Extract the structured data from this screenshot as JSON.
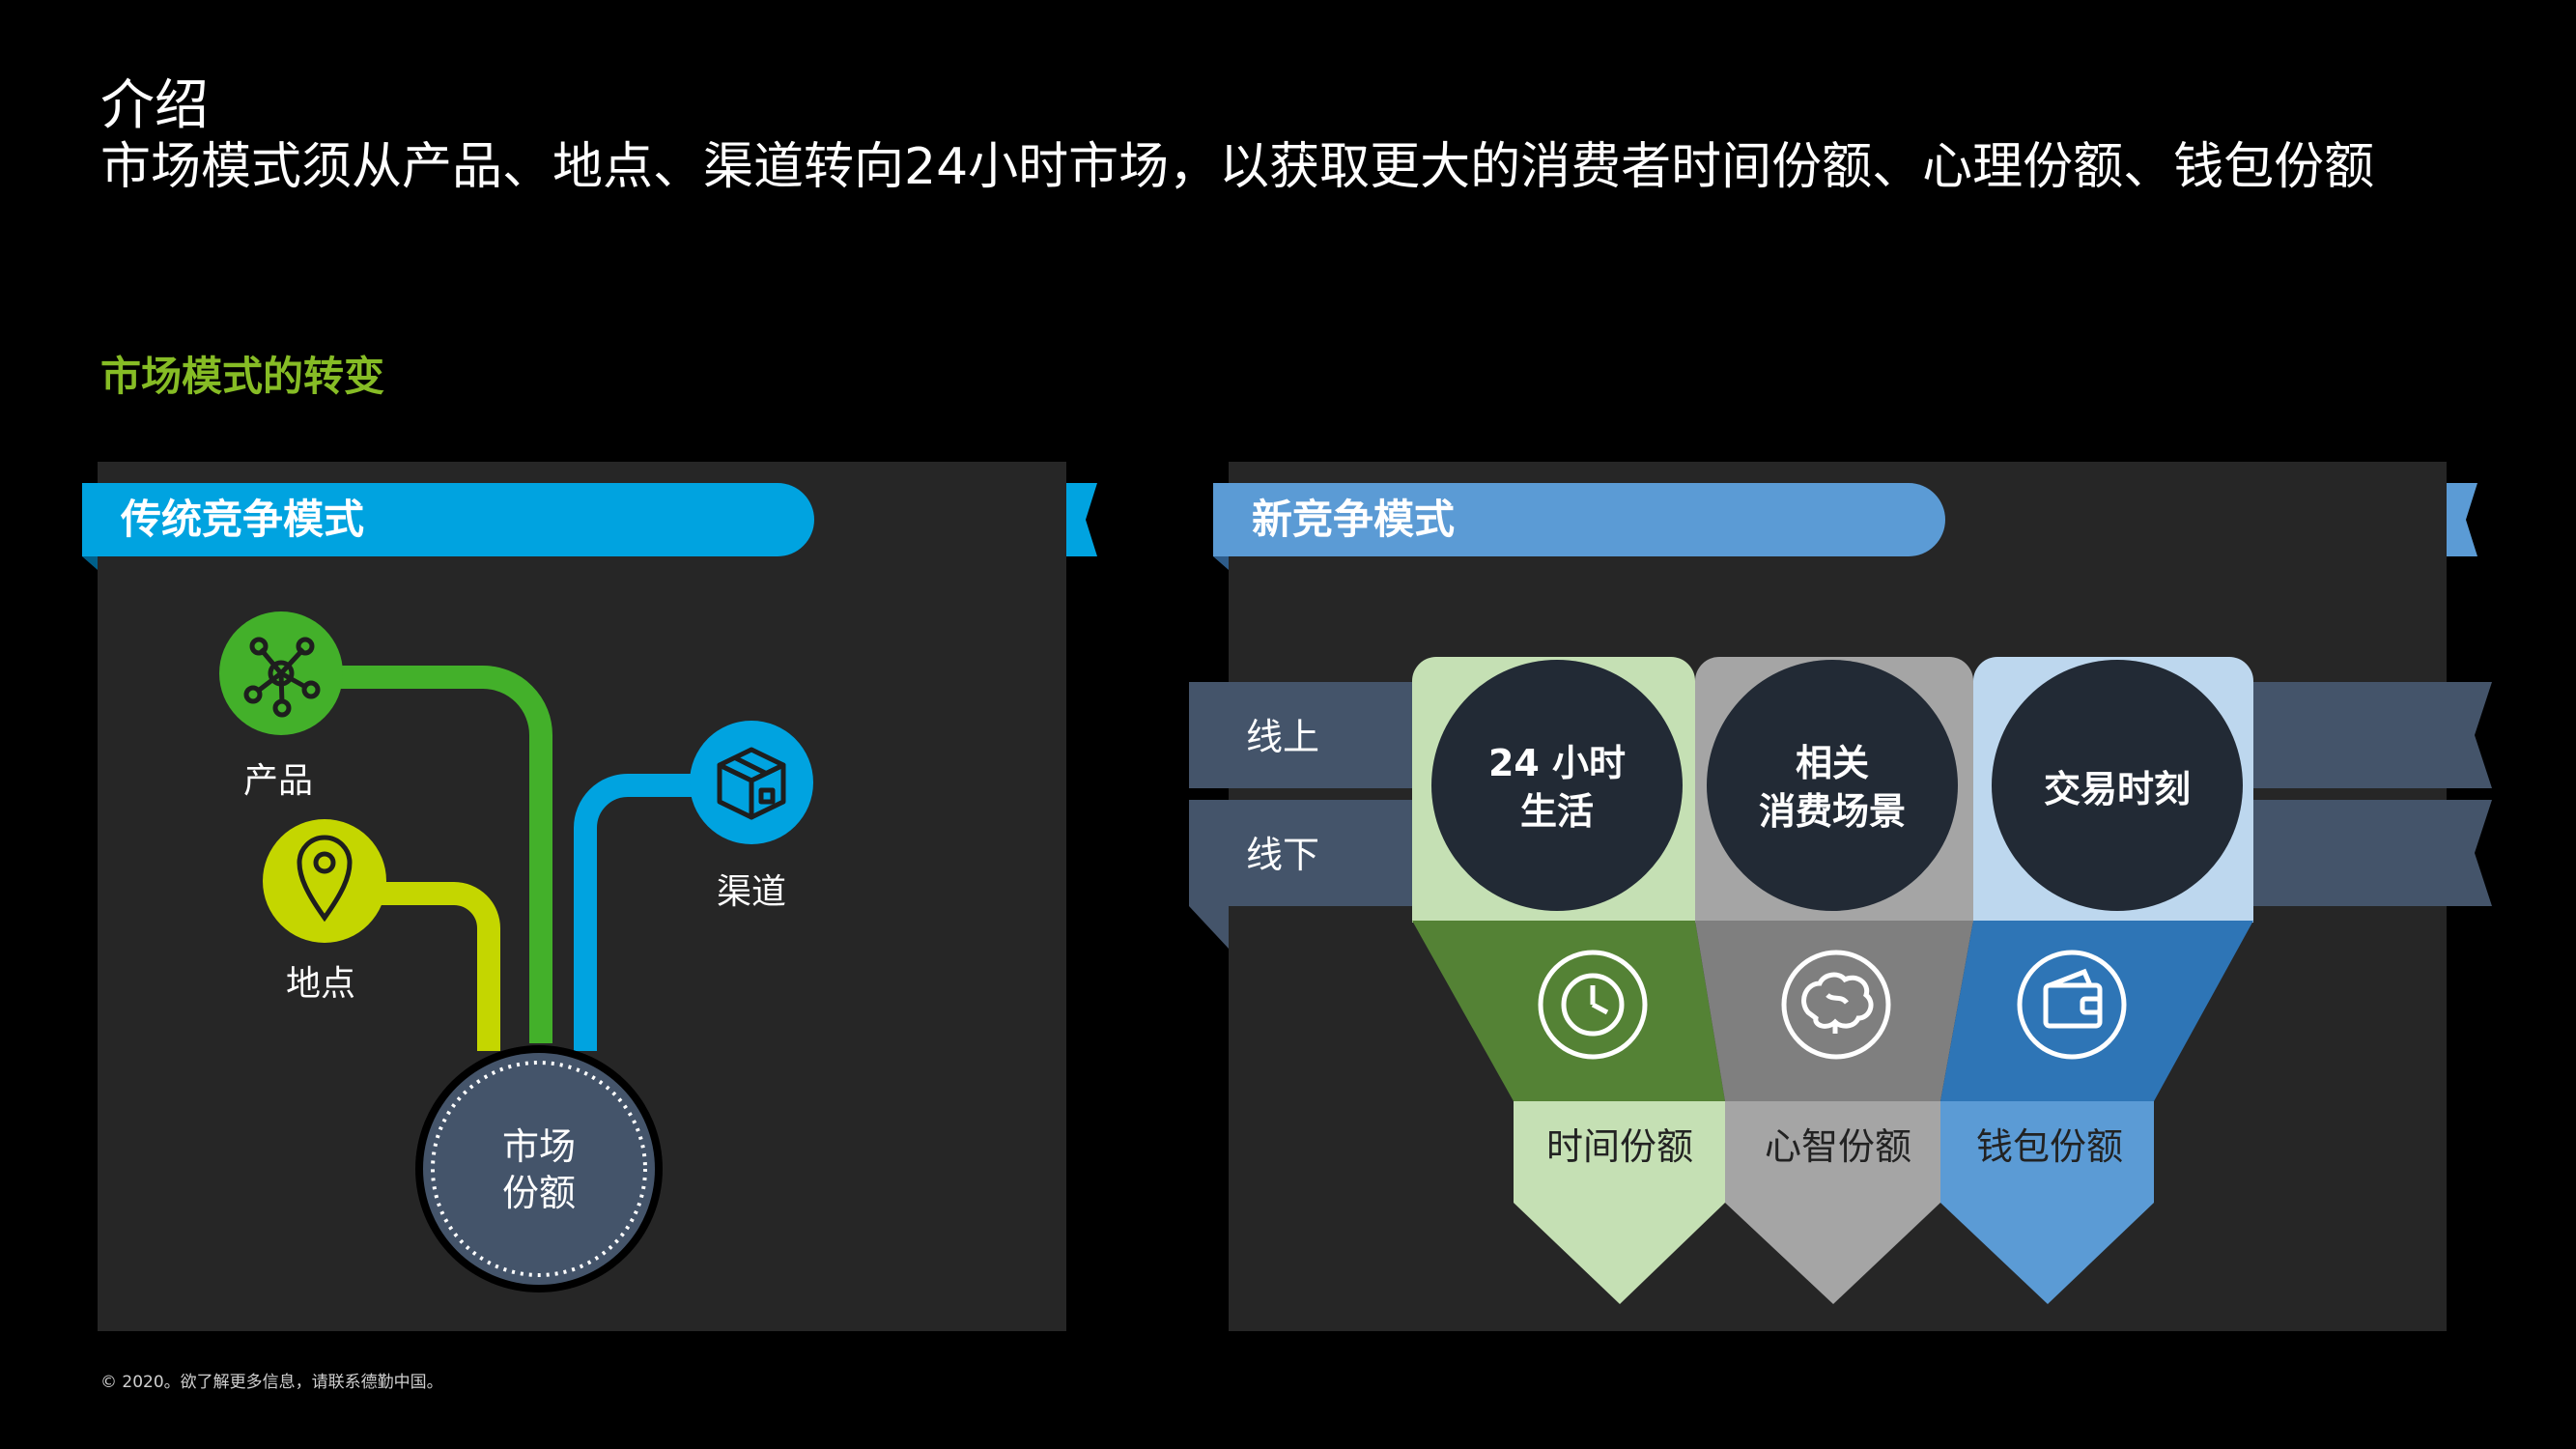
{
  "header": {
    "title": "介绍",
    "subtitle": "市场模式须从产品、地点、渠道转向24小时市场，以获取更大的消费者时间份额、心理份额、钱包份额"
  },
  "section_heading": "市场模式的转变",
  "traditional": {
    "banner": "传统竞争模式",
    "nodes": {
      "product": "产品",
      "place": "地点",
      "channel": "渠道"
    },
    "center_line1": "市场",
    "center_line2": "份额"
  },
  "new_model": {
    "banner": "新竞争模式",
    "rows": {
      "online": "线上",
      "offline": "线下"
    },
    "columns": [
      {
        "circle_line1": "24 小时",
        "circle_line2": "生活",
        "share": "时间份额",
        "icon": "clock-icon"
      },
      {
        "circle_line1": "相关",
        "circle_line2": "消费场景",
        "share": "心智份额",
        "icon": "brain-icon"
      },
      {
        "circle_line1": "交易时刻",
        "circle_line2": "",
        "share": "钱包份额",
        "icon": "wallet-icon"
      }
    ]
  },
  "colors": {
    "panel": "#262626",
    "traditional_banner": "#00a3e0",
    "new_banner": "#5b9bd5",
    "green": "#43b02a",
    "lime": "#c4d600",
    "blue": "#00a3e0",
    "slate": "#44546a",
    "col1_light": "#c5e0b4",
    "col1_dark": "#548235",
    "col2_light": "#a5a5a5",
    "col2_dark": "#7f7f7f",
    "col3_light": "#bdd7ee",
    "col3_dark": "#2e75b6",
    "heading_green": "#86bc25"
  },
  "footer": "© 2020。欲了解更多信息，请联系德勤中国。"
}
